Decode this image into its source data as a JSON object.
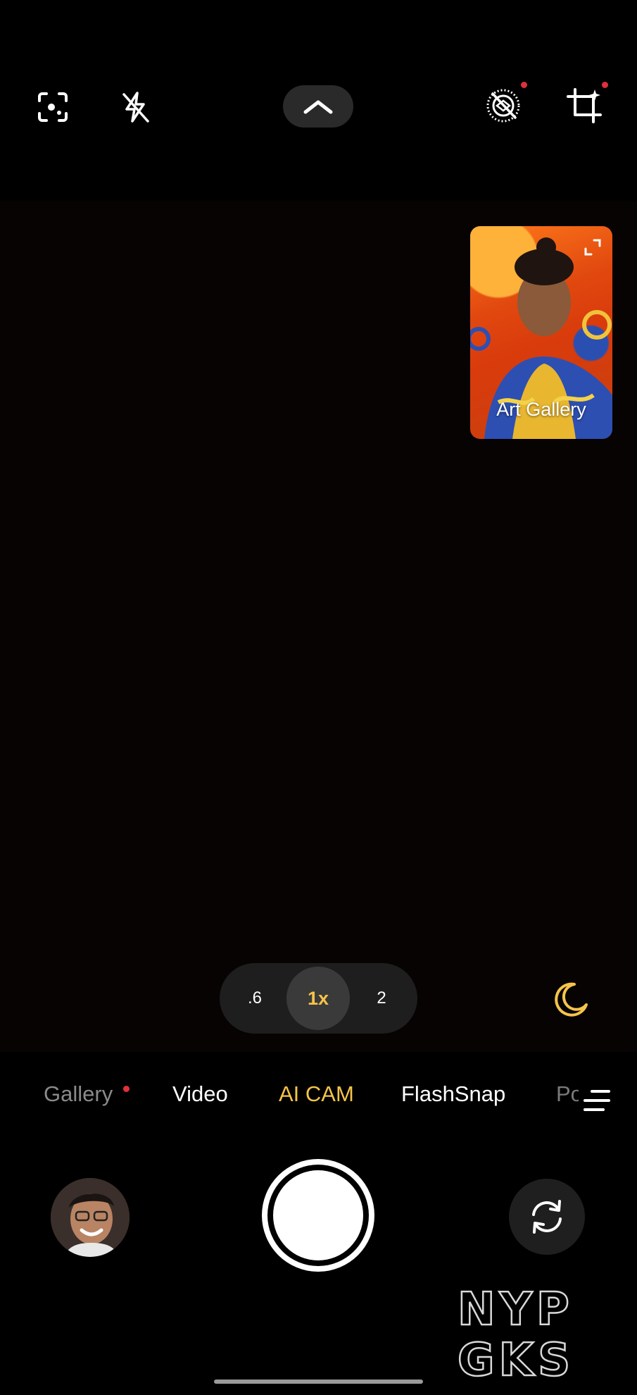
{
  "top_bar": {
    "icons": [
      "focus-scan-icon",
      "flash-off-icon",
      "chevron-up-icon",
      "filter-off-icon",
      "crop-sparkle-icon"
    ]
  },
  "preview_card": {
    "label": "Art Gallery"
  },
  "zoom": {
    "options": [
      ".6",
      "1x",
      "2"
    ],
    "selected": "1x"
  },
  "modes": {
    "items": [
      "Gallery",
      "Video",
      "AI CAM",
      "FlashSnap",
      "Po"
    ],
    "active": "AI CAM"
  },
  "watermark": {
    "line1": "NYP",
    "line2": "GKS"
  },
  "colors": {
    "accent": "#f6c34a",
    "notification_dot": "#e0303a"
  }
}
